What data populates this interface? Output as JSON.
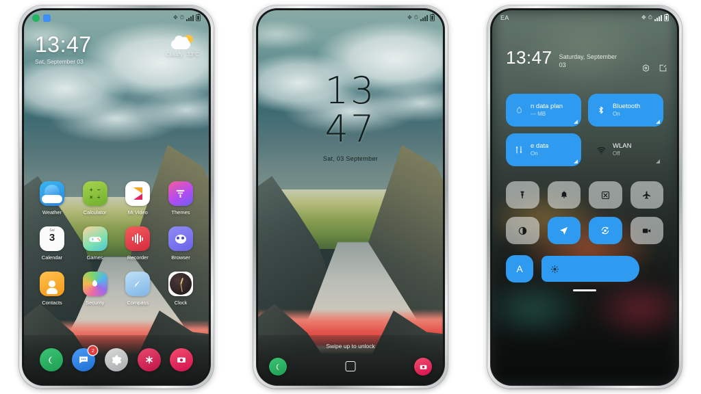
{
  "scene": {
    "background_color": "#ffffff",
    "accent_color": "#2f9bf0",
    "phone_count": 3
  },
  "phone_home": {
    "status_bar": {
      "left_icons": [
        "phone-icon",
        "message-icon"
      ],
      "right_icons": [
        "bluetooth-icon",
        "alarm-icon",
        "signal-icon",
        "battery-icon"
      ]
    },
    "clock": {
      "time": "13:47",
      "date": "Sat, September 03"
    },
    "weather": {
      "icon": "sun-behind-cloud-icon",
      "condition": "Cloudy",
      "temperature": "33°C"
    },
    "apps_row1": [
      {
        "label": "Weather",
        "icon": "weather-icon"
      },
      {
        "label": "Calculator",
        "icon": "calculator-icon",
        "glyphs": [
          "+",
          "−",
          "×",
          "÷"
        ]
      },
      {
        "label": "Mi Video",
        "icon": "mi-video-icon"
      },
      {
        "label": "Themes",
        "icon": "themes-icon"
      }
    ],
    "apps_row2": [
      {
        "label": "Calendar",
        "icon": "calendar-icon",
        "weekday": "Sat",
        "day": "3"
      },
      {
        "label": "Games",
        "icon": "games-icon"
      },
      {
        "label": "Recorder",
        "icon": "recorder-icon"
      },
      {
        "label": "Browser",
        "icon": "browser-icon"
      }
    ],
    "apps_row3": [
      {
        "label": "Contacts",
        "icon": "contacts-icon"
      },
      {
        "label": "Security",
        "icon": "security-icon"
      },
      {
        "label": "Compass",
        "icon": "compass-icon"
      },
      {
        "label": "Clock",
        "icon": "clock-icon"
      }
    ],
    "dock": [
      {
        "name": "phone-dock-icon",
        "badge": ""
      },
      {
        "name": "messages-dock-icon",
        "badge": "2"
      },
      {
        "name": "settings-dock-icon",
        "badge": ""
      },
      {
        "name": "asterisk-dock-icon",
        "badge": ""
      },
      {
        "name": "camera-dock-icon",
        "badge": ""
      }
    ]
  },
  "phone_lock": {
    "status_bar": {
      "right_icons": [
        "bluetooth-icon",
        "alarm-icon",
        "signal-icon",
        "battery-icon"
      ]
    },
    "clock": {
      "hours": "13",
      "minutes": "47",
      "date": "Sat, 03 September"
    },
    "hint": "Swipe up to unlock",
    "shortcuts": {
      "left": "phone-shortcut-icon",
      "right": "camera-shortcut-icon"
    },
    "lock_indicator": "lock-square-icon"
  },
  "phone_quicksettings": {
    "carrier": "EA",
    "status_bar": {
      "right_icons": [
        "bluetooth-icon",
        "alarm-icon",
        "signal-icon",
        "battery-icon"
      ]
    },
    "clock": {
      "time": "13:47",
      "date": "Saturday, September 03"
    },
    "header_actions": [
      "settings-gear-icon",
      "edit-icon"
    ],
    "tiles": [
      {
        "title": "n data plan",
        "subtitle": "— MB",
        "state": "on",
        "icon": "data-plan-icon"
      },
      {
        "title": "Bluetooth",
        "subtitle": "On",
        "state": "on",
        "icon": "bluetooth-icon"
      },
      {
        "title": "e data",
        "subtitle": "On",
        "state": "on",
        "icon": "mobile-data-icon"
      },
      {
        "title": "WLAN",
        "subtitle": "Off",
        "state": "off",
        "icon": "wifi-icon"
      }
    ],
    "toggle_row1": [
      {
        "name": "flashlight-icon",
        "active": false
      },
      {
        "name": "ringer-bell-icon",
        "active": false
      },
      {
        "name": "screenshot-icon",
        "active": false
      },
      {
        "name": "airplane-mode-icon",
        "active": false
      }
    ],
    "toggle_row2": [
      {
        "name": "dark-mode-icon",
        "active": false
      },
      {
        "name": "location-icon",
        "active": true
      },
      {
        "name": "auto-rotate-icon",
        "active": true
      },
      {
        "name": "screen-record-icon",
        "active": false
      }
    ],
    "brightness": {
      "auto_label": "A",
      "icon": "brightness-sun-icon",
      "level_percent": 62
    },
    "drag_handle": "panel-drag-handle"
  }
}
